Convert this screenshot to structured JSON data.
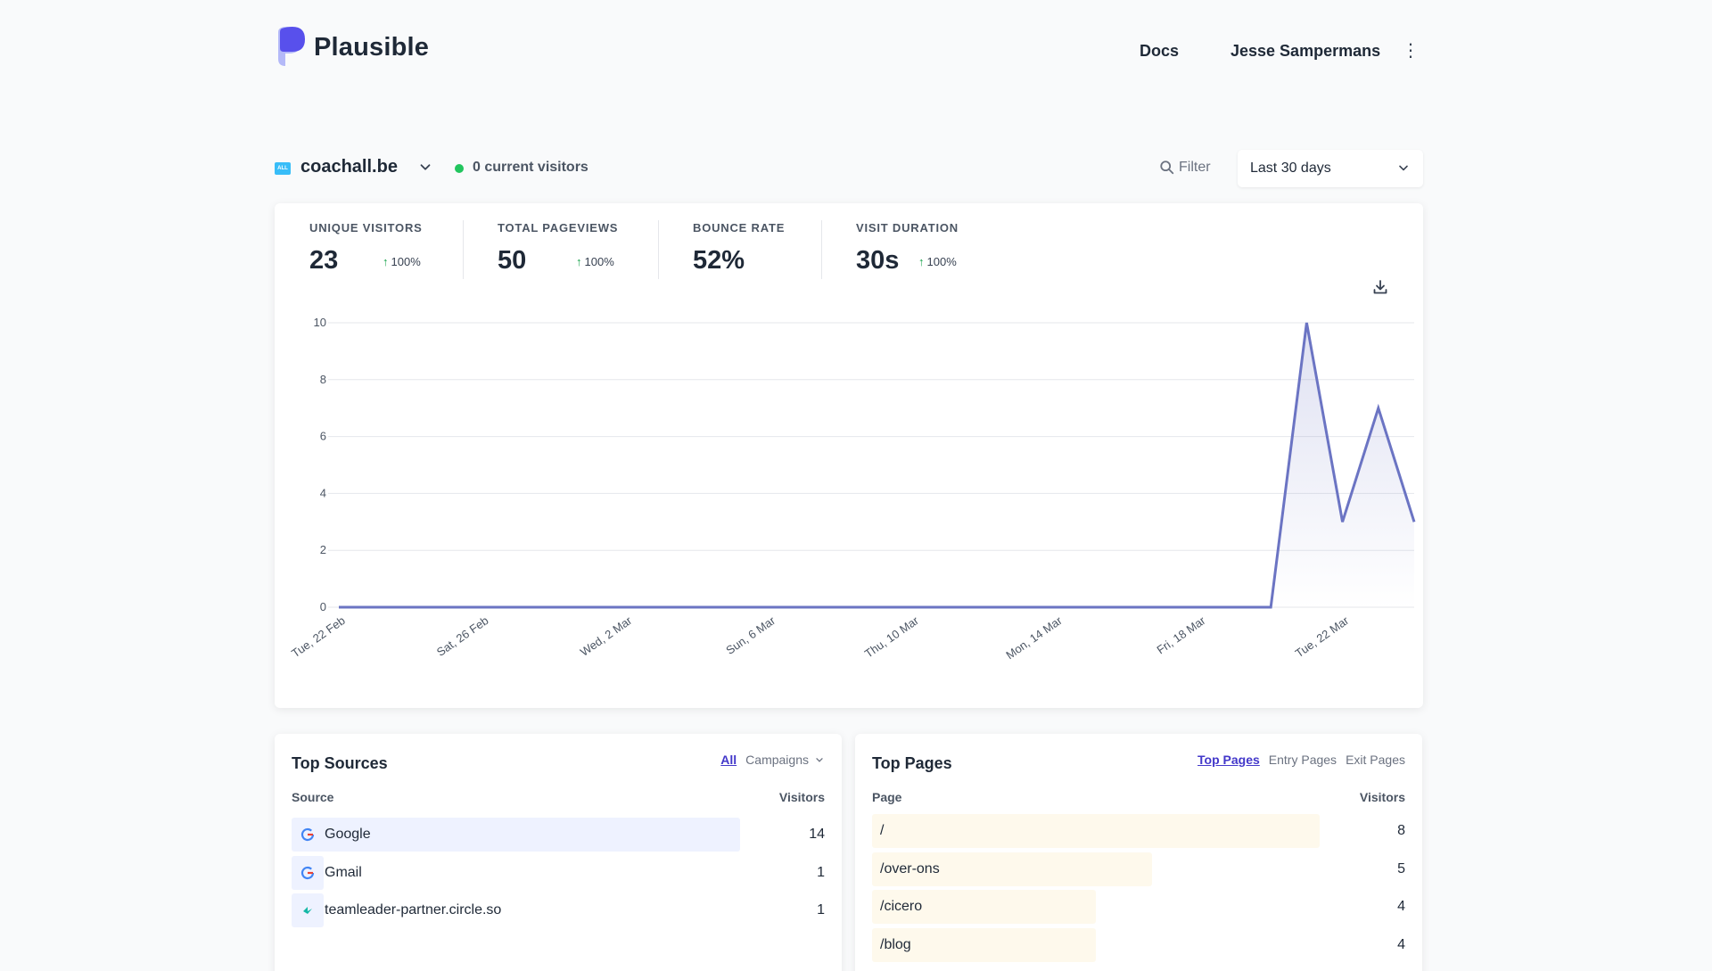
{
  "header": {
    "logo_text": "Plausible",
    "docs_label": "Docs",
    "user_name": "Jesse Sampermans"
  },
  "site": {
    "favicon_text": "ALL",
    "domain": "coachall.be",
    "current_visitors": "0 current visitors",
    "filter_label": "Filter",
    "period_label": "Last 30 days"
  },
  "stats": [
    {
      "label": "UNIQUE VISITORS",
      "value": "23",
      "change": "100%"
    },
    {
      "label": "TOTAL PAGEVIEWS",
      "value": "50",
      "change": "100%"
    },
    {
      "label": "BOUNCE RATE",
      "value": "52%",
      "change": ""
    },
    {
      "label": "VISIT DURATION",
      "value": "30s",
      "change": "100%"
    }
  ],
  "chart_data": {
    "type": "area",
    "x_ticks": [
      "Tue, 22 Feb",
      "Sat, 26 Feb",
      "Wed, 2 Mar",
      "Sun, 6 Mar",
      "Thu, 10 Mar",
      "Mon, 14 Mar",
      "Fri, 18 Mar",
      "Tue, 22 Mar"
    ],
    "y_ticks": [
      0,
      2,
      4,
      6,
      8,
      10
    ],
    "ylim": [
      0,
      10
    ],
    "series": [
      {
        "values": [
          0,
          0,
          0,
          0,
          0,
          0,
          0,
          0,
          0,
          0,
          0,
          0,
          0,
          0,
          0,
          0,
          0,
          0,
          0,
          0,
          0,
          0,
          0,
          0,
          0,
          0,
          0,
          10,
          3,
          7,
          3
        ]
      }
    ],
    "grid": true,
    "color": "#6b74c3"
  },
  "top_sources": {
    "title": "Top Sources",
    "tab_all": "All",
    "tab_campaigns": "Campaigns",
    "col_source": "Source",
    "col_visitors": "Visitors",
    "rows": [
      {
        "label": "Google",
        "value": "14",
        "fraction": 1.0
      },
      {
        "label": "Gmail",
        "value": "1",
        "fraction": 0.07
      },
      {
        "label": "teamleader-partner.circle.so",
        "value": "1",
        "fraction": 0.07
      }
    ]
  },
  "top_pages": {
    "title": "Top Pages",
    "tab_top": "Top Pages",
    "tab_entry": "Entry Pages",
    "tab_exit": "Exit Pages",
    "col_page": "Page",
    "col_visitors": "Visitors",
    "rows": [
      {
        "label": "/",
        "value": "8",
        "fraction": 1.0
      },
      {
        "label": "/over-ons",
        "value": "5",
        "fraction": 0.625
      },
      {
        "label": "/cicero",
        "value": "4",
        "fraction": 0.5
      },
      {
        "label": "/blog",
        "value": "4",
        "fraction": 0.5
      }
    ]
  },
  "colors": {
    "accent": "#4338ca",
    "line": "#6b74c3",
    "source_bar": "#eef2ff",
    "page_bar": "#fef9ec",
    "live_dot": "#22c55e"
  }
}
